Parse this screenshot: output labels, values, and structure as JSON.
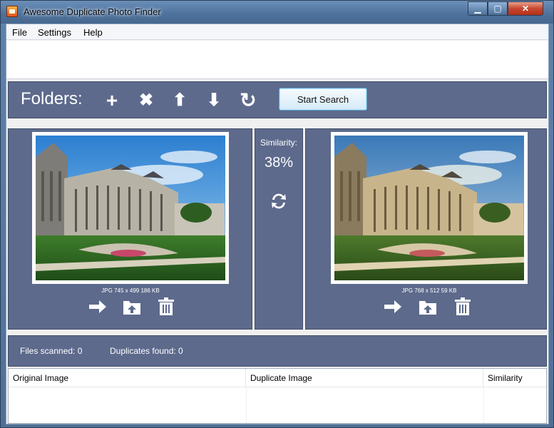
{
  "window": {
    "title": "Awesome Duplicate Photo Finder",
    "minimize": "▁",
    "maximize": "▢",
    "close": "✕"
  },
  "menu": {
    "file": "File",
    "settings": "Settings",
    "help": "Help"
  },
  "toolbar": {
    "folders_label": "Folders:",
    "add_icon": "+",
    "remove_icon": "✖",
    "up_icon": "⬆",
    "down_icon": "⬇",
    "reset_icon": "↻",
    "start_search": "Start Search"
  },
  "left_photo": {
    "info": "JPG  745 x 499  186 KB"
  },
  "right_photo": {
    "info": "JPG  768 x 512  59 KB"
  },
  "similarity": {
    "label": "Similarity:",
    "value": "38%"
  },
  "status": {
    "files_scanned": "Files scanned: 0",
    "duplicates_found": "Duplicates found: 0"
  },
  "table": {
    "columns": [
      "Original Image",
      "Duplicate Image",
      "Similarity"
    ]
  },
  "colors": {
    "panel": "#5d6a8c",
    "accent": "#5ba4d6"
  }
}
